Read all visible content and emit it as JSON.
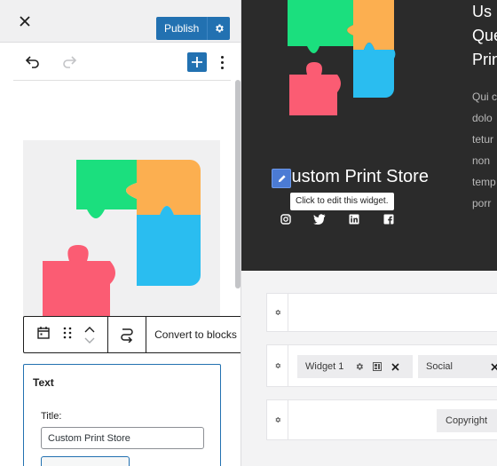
{
  "editor": {
    "publish_label": "Publish",
    "convert_label": "Convert to blocks",
    "text_widget": {
      "heading": "Text",
      "title_label": "Title:",
      "title_value": "Custom Print Store"
    }
  },
  "preview": {
    "site_title": "Custom Print Store",
    "tooltip": "Click to edit this widget.",
    "heading_lines": [
      "Us",
      "Que",
      "Prin"
    ],
    "paragraph_lines": [
      "Qui c",
      "dolo",
      "tetur",
      "non",
      "temp",
      "porr"
    ],
    "widgets": {
      "widget1_label": "Widget 1",
      "social_label": "Social",
      "copyright_label": "Copyright"
    }
  },
  "icons": [
    "close-icon",
    "gear-icon",
    "undo-icon",
    "redo-icon",
    "plus-icon",
    "more-vertical-icon",
    "calendar-icon",
    "drag-handle-icon",
    "chevron-up-icon",
    "chevron-down-icon",
    "transform-icon",
    "pencil-icon",
    "instagram-icon",
    "twitter-icon",
    "linkedin-icon",
    "facebook-icon",
    "gear-small-icon",
    "widget-icon",
    "x-icon"
  ],
  "colors": {
    "accent": "#2271b1",
    "dark_bg": "#2b2b2b",
    "puzzle_green": "#1bdf7e",
    "puzzle_orange": "#fcaf50",
    "puzzle_blue": "#2abdf0",
    "puzzle_pink": "#fb5c73"
  }
}
